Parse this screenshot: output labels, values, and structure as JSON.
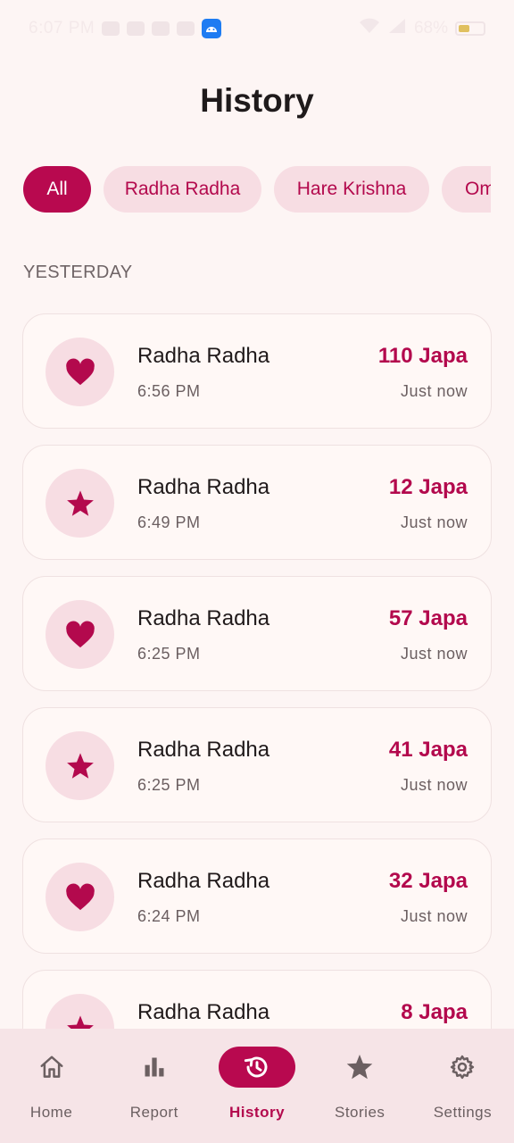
{
  "status_bar": {
    "time": "6:07 PM",
    "battery": "68%"
  },
  "title": "History",
  "filters": [
    {
      "label": "All",
      "active": true
    },
    {
      "label": "Radha Radha",
      "active": false
    },
    {
      "label": "Hare Krishna",
      "active": false
    },
    {
      "label": "Om",
      "active": false
    }
  ],
  "section_label": "YESTERDAY",
  "entries": [
    {
      "icon": "heart-icon",
      "name": "Radha Radha",
      "time": "6:56 PM",
      "count": "110 Japa",
      "ago": "Just now"
    },
    {
      "icon": "star-icon",
      "name": "Radha Radha",
      "time": "6:49 PM",
      "count": "12 Japa",
      "ago": "Just now"
    },
    {
      "icon": "heart-icon",
      "name": "Radha Radha",
      "time": "6:25 PM",
      "count": "57 Japa",
      "ago": "Just now"
    },
    {
      "icon": "star-icon",
      "name": "Radha Radha",
      "time": "6:25 PM",
      "count": "41 Japa",
      "ago": "Just now"
    },
    {
      "icon": "heart-icon",
      "name": "Radha Radha",
      "time": "6:24 PM",
      "count": "32 Japa",
      "ago": "Just now"
    },
    {
      "icon": "star-icon",
      "name": "Radha Radha",
      "time": "",
      "count": "8 Japa",
      "ago": ""
    }
  ],
  "nav": [
    {
      "label": "Home",
      "icon": "home-icon",
      "active": false
    },
    {
      "label": "Report",
      "icon": "bar-chart-icon",
      "active": false
    },
    {
      "label": "History",
      "icon": "history-icon",
      "active": true
    },
    {
      "label": "Stories",
      "icon": "star-icon",
      "active": false
    },
    {
      "label": "Settings",
      "icon": "gear-icon",
      "active": false
    }
  ],
  "colors": {
    "accent": "#b8094f",
    "accent_text": "#b3094d",
    "chip_bg": "#f7dde3",
    "page_bg": "#fdf5f4",
    "nav_bg": "#f6e4e7"
  }
}
